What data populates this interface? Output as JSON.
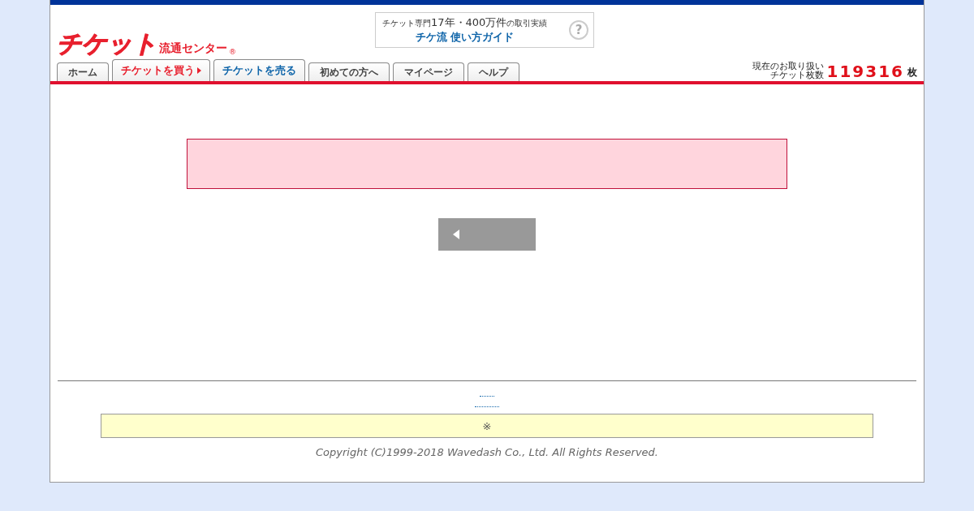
{
  "logo": {
    "main": "チケット",
    "sub": "流通センター",
    "mark": "®"
  },
  "guide_banner": {
    "lead": "チケット専門",
    "highlight": "17年・400万件",
    "tail": "の取引実績",
    "title": "チケ流 使い方ガイド",
    "icon": "?"
  },
  "tabs": [
    {
      "label": "ホーム",
      "kind": "plain"
    },
    {
      "label": "チケットを買う",
      "kind": "buy"
    },
    {
      "label": "チケットを売る",
      "kind": "sell"
    },
    {
      "label": "初めての方へ",
      "kind": "plain"
    },
    {
      "label": "マイページ",
      "kind": "plain"
    },
    {
      "label": "ヘルプ",
      "kind": "plain"
    }
  ],
  "ticket_count": {
    "label_line_1": "現在のお取り扱い",
    "label_line_2": "チケット枚数",
    "value": "119316",
    "unit": "枚"
  },
  "footer": {
    "note": "※",
    "copyright": "Copyright (C)1999-2018 Wavedash Co., Ltd. All Rights Reserved."
  }
}
